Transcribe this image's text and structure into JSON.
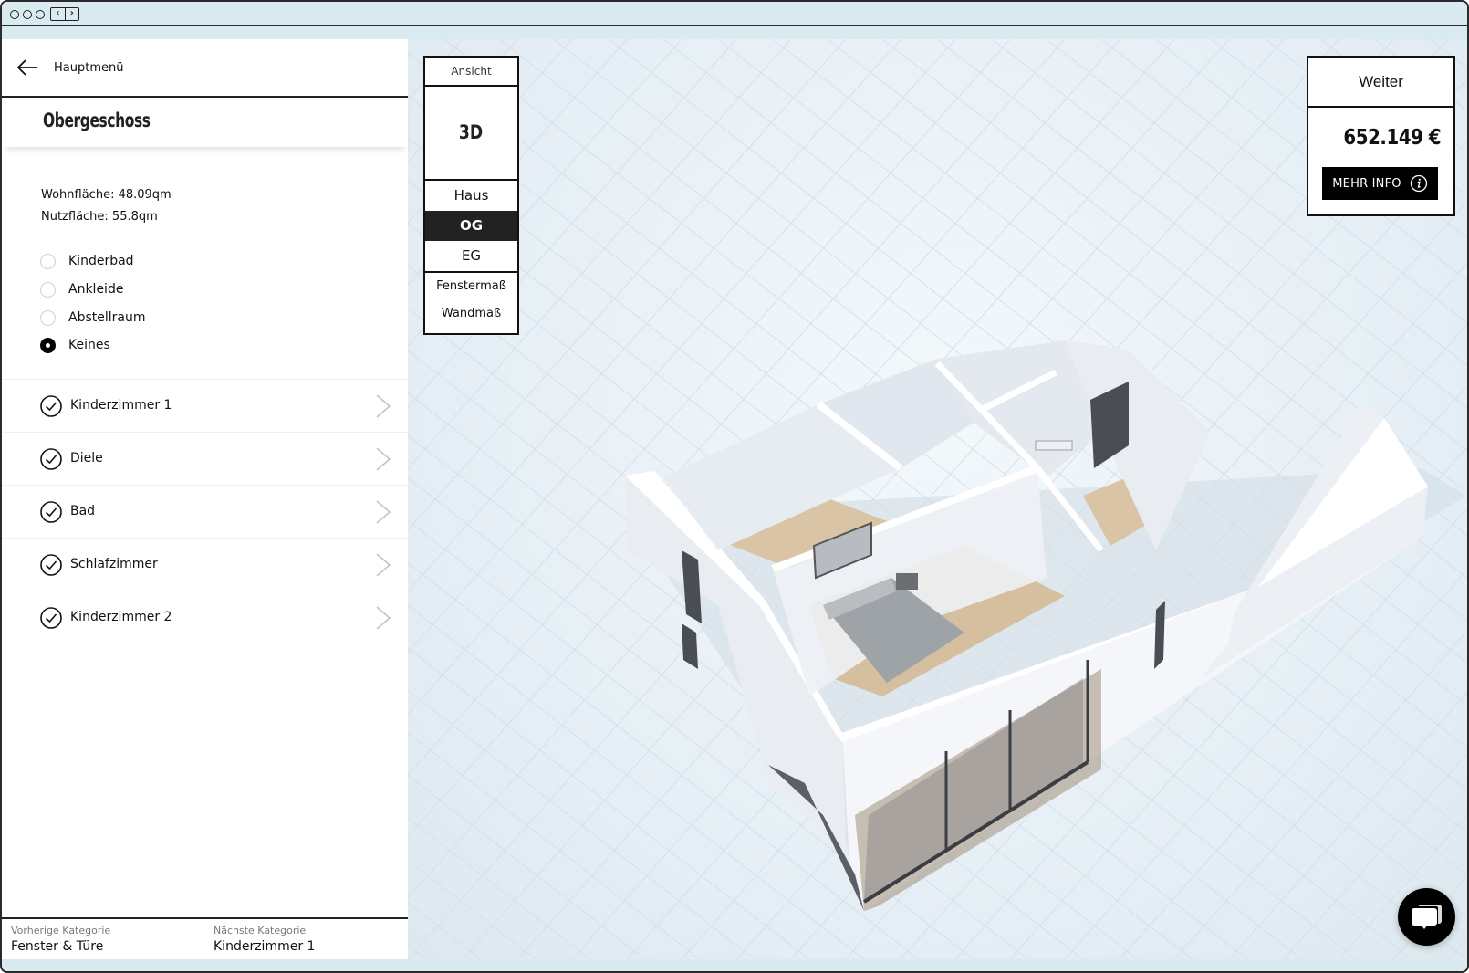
{
  "window": {
    "titlebar_nav_back": "‹",
    "titlebar_nav_forward": "›"
  },
  "sidebar": {
    "back_label": "Hauptmenü",
    "floor_title": "Obergeschoss",
    "areas": {
      "wohnflaeche": "Wohnfläche: 48.09qm",
      "nutzflaeche": "Nutzfläche: 55.8qm"
    },
    "options": [
      {
        "label": "Kinderbad",
        "selected": false
      },
      {
        "label": "Ankleide",
        "selected": false
      },
      {
        "label": "Abstellraum",
        "selected": false
      },
      {
        "label": "Keines",
        "selected": true
      }
    ],
    "rooms": [
      {
        "label": "Kinderzimmer 1",
        "done": true
      },
      {
        "label": "Diele",
        "done": true
      },
      {
        "label": "Bad",
        "done": true
      },
      {
        "label": "Schlafzimmer",
        "done": true
      },
      {
        "label": "Kinderzimmer 2",
        "done": true
      }
    ],
    "footer": {
      "prev_caption": "Vorherige Kategorie",
      "prev_value": "Fenster & Türe",
      "next_caption": "Nächste Kategorie",
      "next_value": "Kinderzimmer 1"
    }
  },
  "view_panel": {
    "title": "Ansicht",
    "mode": "3D",
    "floors": [
      {
        "label": "Haus",
        "active": false
      },
      {
        "label": "OG",
        "active": true
      },
      {
        "label": "EG",
        "active": false
      }
    ],
    "measures": [
      "Fenstermaß",
      "Wandmaß"
    ]
  },
  "price_panel": {
    "next_label": "Weiter",
    "price": "652.149 €",
    "info_label": "MEHR INFO"
  },
  "colors": {
    "frame": "#2b2b2b",
    "chrome": "#d9eaf1",
    "accent_dark": "#222222",
    "canvas_bg": "#e6eff5",
    "floor_wood": "#d8c2a6",
    "wall": "#f3f5f8"
  },
  "icons": {
    "back": "arrow-left-icon",
    "check": "check-circle-icon",
    "chevron": "chevron-right-icon",
    "info": "info-icon",
    "chat": "chat-bubble-icon"
  }
}
